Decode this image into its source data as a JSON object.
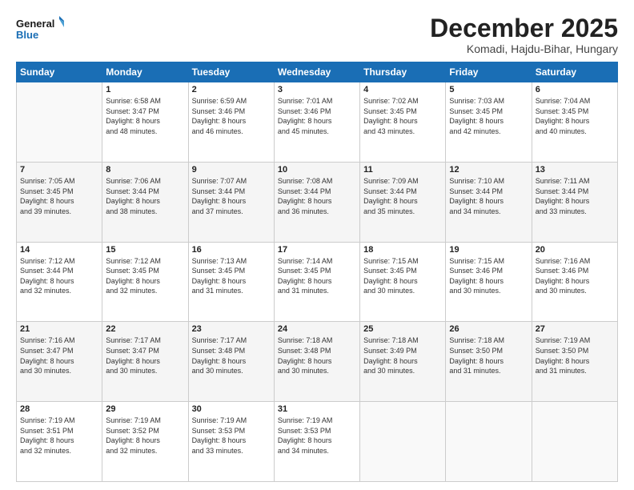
{
  "logo": {
    "line1": "General",
    "line2": "Blue"
  },
  "title": "December 2025",
  "subtitle": "Komadi, Hajdu-Bihar, Hungary",
  "days_header": [
    "Sunday",
    "Monday",
    "Tuesday",
    "Wednesday",
    "Thursday",
    "Friday",
    "Saturday"
  ],
  "weeks": [
    [
      {
        "day": "",
        "info": ""
      },
      {
        "day": "1",
        "info": "Sunrise: 6:58 AM\nSunset: 3:47 PM\nDaylight: 8 hours\nand 48 minutes."
      },
      {
        "day": "2",
        "info": "Sunrise: 6:59 AM\nSunset: 3:46 PM\nDaylight: 8 hours\nand 46 minutes."
      },
      {
        "day": "3",
        "info": "Sunrise: 7:01 AM\nSunset: 3:46 PM\nDaylight: 8 hours\nand 45 minutes."
      },
      {
        "day": "4",
        "info": "Sunrise: 7:02 AM\nSunset: 3:45 PM\nDaylight: 8 hours\nand 43 minutes."
      },
      {
        "day": "5",
        "info": "Sunrise: 7:03 AM\nSunset: 3:45 PM\nDaylight: 8 hours\nand 42 minutes."
      },
      {
        "day": "6",
        "info": "Sunrise: 7:04 AM\nSunset: 3:45 PM\nDaylight: 8 hours\nand 40 minutes."
      }
    ],
    [
      {
        "day": "7",
        "info": "Sunrise: 7:05 AM\nSunset: 3:45 PM\nDaylight: 8 hours\nand 39 minutes."
      },
      {
        "day": "8",
        "info": "Sunrise: 7:06 AM\nSunset: 3:44 PM\nDaylight: 8 hours\nand 38 minutes."
      },
      {
        "day": "9",
        "info": "Sunrise: 7:07 AM\nSunset: 3:44 PM\nDaylight: 8 hours\nand 37 minutes."
      },
      {
        "day": "10",
        "info": "Sunrise: 7:08 AM\nSunset: 3:44 PM\nDaylight: 8 hours\nand 36 minutes."
      },
      {
        "day": "11",
        "info": "Sunrise: 7:09 AM\nSunset: 3:44 PM\nDaylight: 8 hours\nand 35 minutes."
      },
      {
        "day": "12",
        "info": "Sunrise: 7:10 AM\nSunset: 3:44 PM\nDaylight: 8 hours\nand 34 minutes."
      },
      {
        "day": "13",
        "info": "Sunrise: 7:11 AM\nSunset: 3:44 PM\nDaylight: 8 hours\nand 33 minutes."
      }
    ],
    [
      {
        "day": "14",
        "info": "Sunrise: 7:12 AM\nSunset: 3:44 PM\nDaylight: 8 hours\nand 32 minutes."
      },
      {
        "day": "15",
        "info": "Sunrise: 7:12 AM\nSunset: 3:45 PM\nDaylight: 8 hours\nand 32 minutes."
      },
      {
        "day": "16",
        "info": "Sunrise: 7:13 AM\nSunset: 3:45 PM\nDaylight: 8 hours\nand 31 minutes."
      },
      {
        "day": "17",
        "info": "Sunrise: 7:14 AM\nSunset: 3:45 PM\nDaylight: 8 hours\nand 31 minutes."
      },
      {
        "day": "18",
        "info": "Sunrise: 7:15 AM\nSunset: 3:45 PM\nDaylight: 8 hours\nand 30 minutes."
      },
      {
        "day": "19",
        "info": "Sunrise: 7:15 AM\nSunset: 3:46 PM\nDaylight: 8 hours\nand 30 minutes."
      },
      {
        "day": "20",
        "info": "Sunrise: 7:16 AM\nSunset: 3:46 PM\nDaylight: 8 hours\nand 30 minutes."
      }
    ],
    [
      {
        "day": "21",
        "info": "Sunrise: 7:16 AM\nSunset: 3:47 PM\nDaylight: 8 hours\nand 30 minutes."
      },
      {
        "day": "22",
        "info": "Sunrise: 7:17 AM\nSunset: 3:47 PM\nDaylight: 8 hours\nand 30 minutes."
      },
      {
        "day": "23",
        "info": "Sunrise: 7:17 AM\nSunset: 3:48 PM\nDaylight: 8 hours\nand 30 minutes."
      },
      {
        "day": "24",
        "info": "Sunrise: 7:18 AM\nSunset: 3:48 PM\nDaylight: 8 hours\nand 30 minutes."
      },
      {
        "day": "25",
        "info": "Sunrise: 7:18 AM\nSunset: 3:49 PM\nDaylight: 8 hours\nand 30 minutes."
      },
      {
        "day": "26",
        "info": "Sunrise: 7:18 AM\nSunset: 3:50 PM\nDaylight: 8 hours\nand 31 minutes."
      },
      {
        "day": "27",
        "info": "Sunrise: 7:19 AM\nSunset: 3:50 PM\nDaylight: 8 hours\nand 31 minutes."
      }
    ],
    [
      {
        "day": "28",
        "info": "Sunrise: 7:19 AM\nSunset: 3:51 PM\nDaylight: 8 hours\nand 32 minutes."
      },
      {
        "day": "29",
        "info": "Sunrise: 7:19 AM\nSunset: 3:52 PM\nDaylight: 8 hours\nand 32 minutes."
      },
      {
        "day": "30",
        "info": "Sunrise: 7:19 AM\nSunset: 3:53 PM\nDaylight: 8 hours\nand 33 minutes."
      },
      {
        "day": "31",
        "info": "Sunrise: 7:19 AM\nSunset: 3:53 PM\nDaylight: 8 hours\nand 34 minutes."
      },
      {
        "day": "",
        "info": ""
      },
      {
        "day": "",
        "info": ""
      },
      {
        "day": "",
        "info": ""
      }
    ]
  ]
}
